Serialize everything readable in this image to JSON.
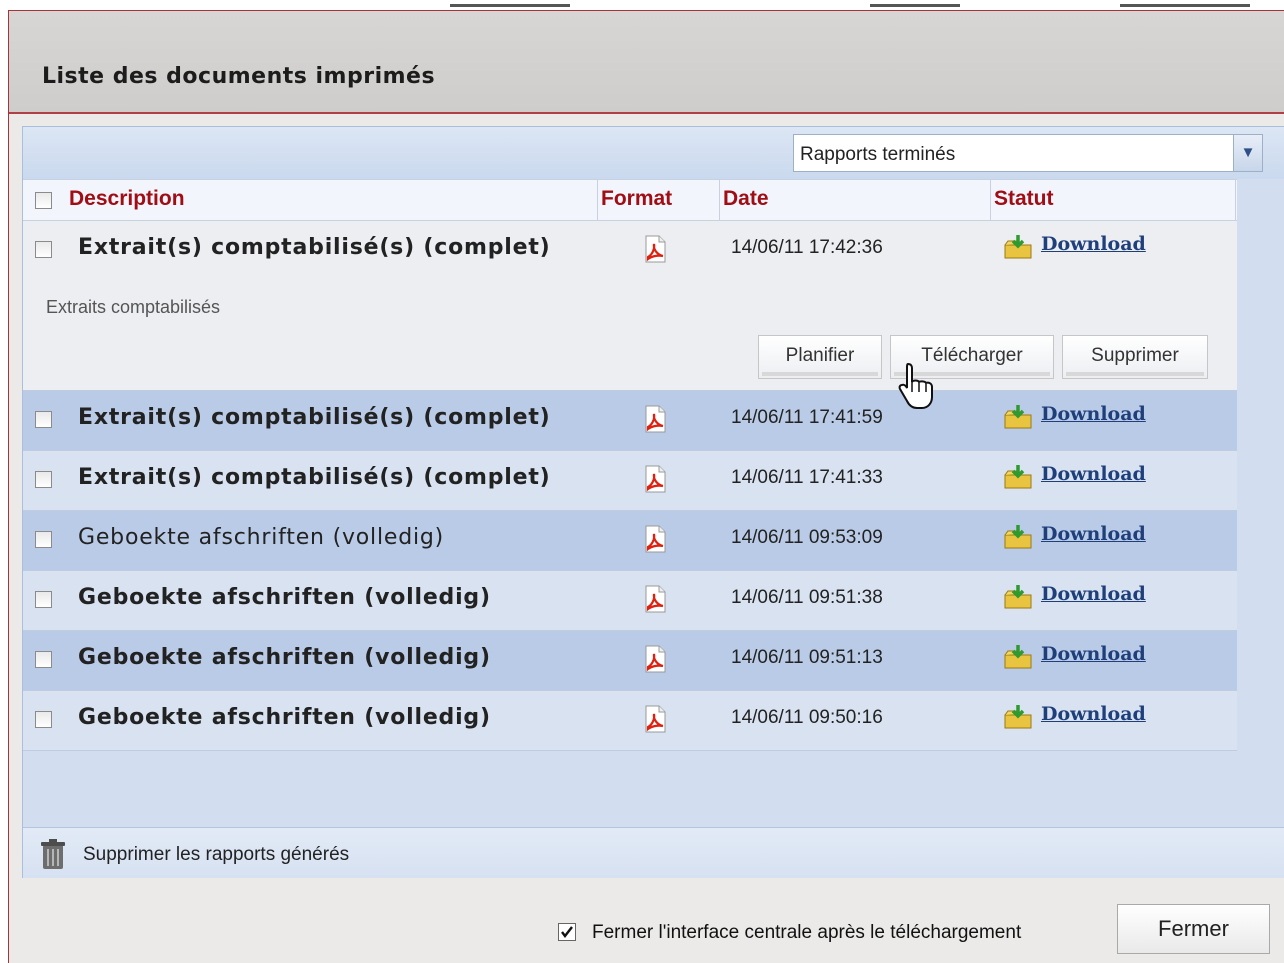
{
  "dialog": {
    "title": "Liste des documents imprimés",
    "accent_color": "#a00d14"
  },
  "filter": {
    "selected": "Rapports terminés"
  },
  "table": {
    "columns": [
      "Description",
      "Format",
      "Date",
      "Statut"
    ],
    "rows": [
      {
        "description": "Extrait(s) comptabilisé(s) (complet)",
        "bold": true,
        "format": "pdf-icon",
        "date": "14/06/11 17:42:36",
        "status": "Download",
        "expanded": true,
        "details": "Extraits comptabilisés",
        "actions": [
          "Planifier",
          "Télécharger",
          "Supprimer"
        ]
      },
      {
        "description": "Extrait(s) comptabilisé(s) (complet)",
        "bold": true,
        "format": "pdf-icon",
        "date": "14/06/11 17:41:59",
        "status": "Download"
      },
      {
        "description": "Extrait(s) comptabilisé(s) (complet)",
        "bold": true,
        "format": "pdf-icon",
        "date": "14/06/11 17:41:33",
        "status": "Download"
      },
      {
        "description": "Geboekte afschriften (volledig)",
        "bold": false,
        "format": "pdf-icon",
        "date": "14/06/11 09:53:09",
        "status": "Download"
      },
      {
        "description": "Geboekte afschriften (volledig)",
        "bold": true,
        "format": "pdf-icon",
        "date": "14/06/11 09:51:38",
        "status": "Download"
      },
      {
        "description": "Geboekte afschriften (volledig)",
        "bold": true,
        "format": "pdf-icon",
        "date": "14/06/11 09:51:13",
        "status": "Download"
      },
      {
        "description": "Geboekte afschriften (volledig)",
        "bold": true,
        "format": "pdf-icon",
        "date": "14/06/11 09:50:16",
        "status": "Download"
      }
    ]
  },
  "footer": {
    "delete_generated": "Supprimer les rapports générés",
    "close_after_download": "Fermer l'interface centrale après le téléchargement",
    "close_after_download_checked": true,
    "close_button": "Fermer"
  }
}
